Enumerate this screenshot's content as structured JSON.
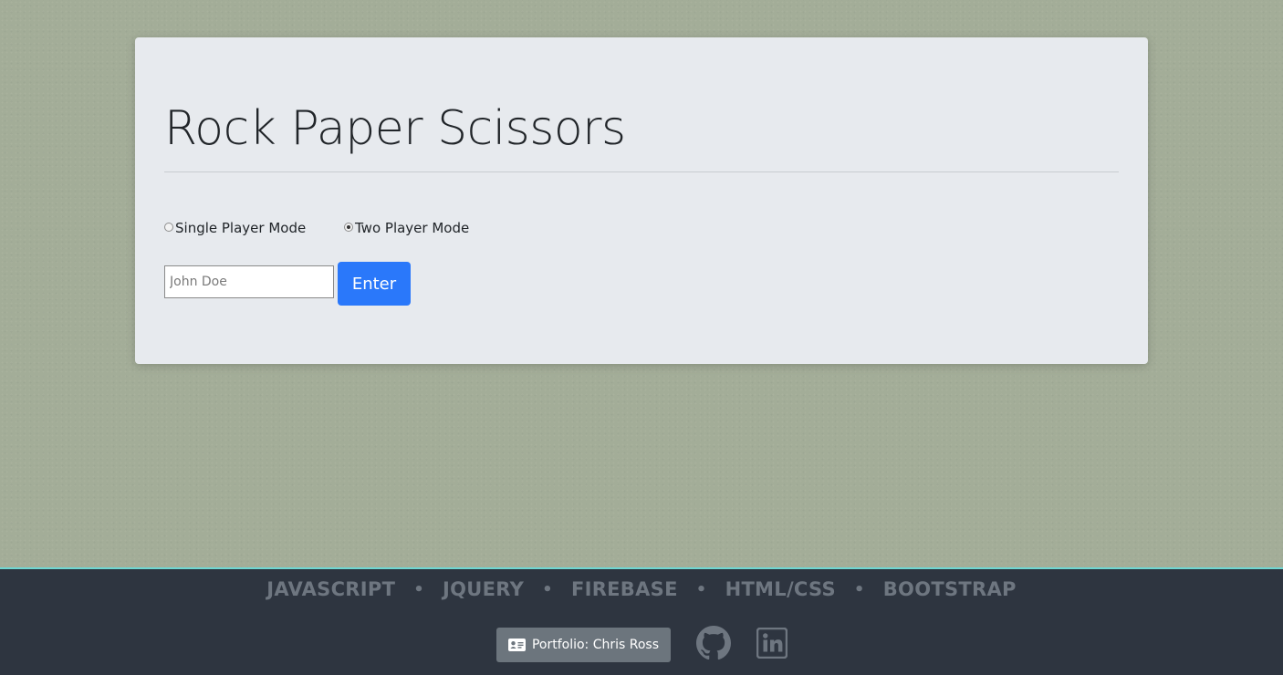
{
  "game": {
    "title": "Rock Paper Scissors",
    "modes": [
      {
        "label": "Single Player Mode",
        "selected": false
      },
      {
        "label": "Two Player Mode",
        "selected": true
      }
    ],
    "name_input": {
      "placeholder": "John Doe",
      "value": ""
    },
    "enter_label": "Enter"
  },
  "footer": {
    "technologies": [
      "JAVASCRIPT",
      "JQUERY",
      "FIREBASE",
      "HTML/CSS",
      "BOOTSTRAP"
    ],
    "separator": "•",
    "portfolio_label": "Portfolio: Chris Ross",
    "icons": {
      "portfolio": "id-card-icon",
      "github": "github-icon",
      "linkedin": "linkedin-icon"
    },
    "accent_color": "#6fd6d2",
    "background_color": "#2e3540"
  },
  "colors": {
    "page_background": "#a3ad98",
    "card_background": "#e7eaee",
    "primary_button": "#2a78fa",
    "secondary_button": "#6c757d"
  }
}
